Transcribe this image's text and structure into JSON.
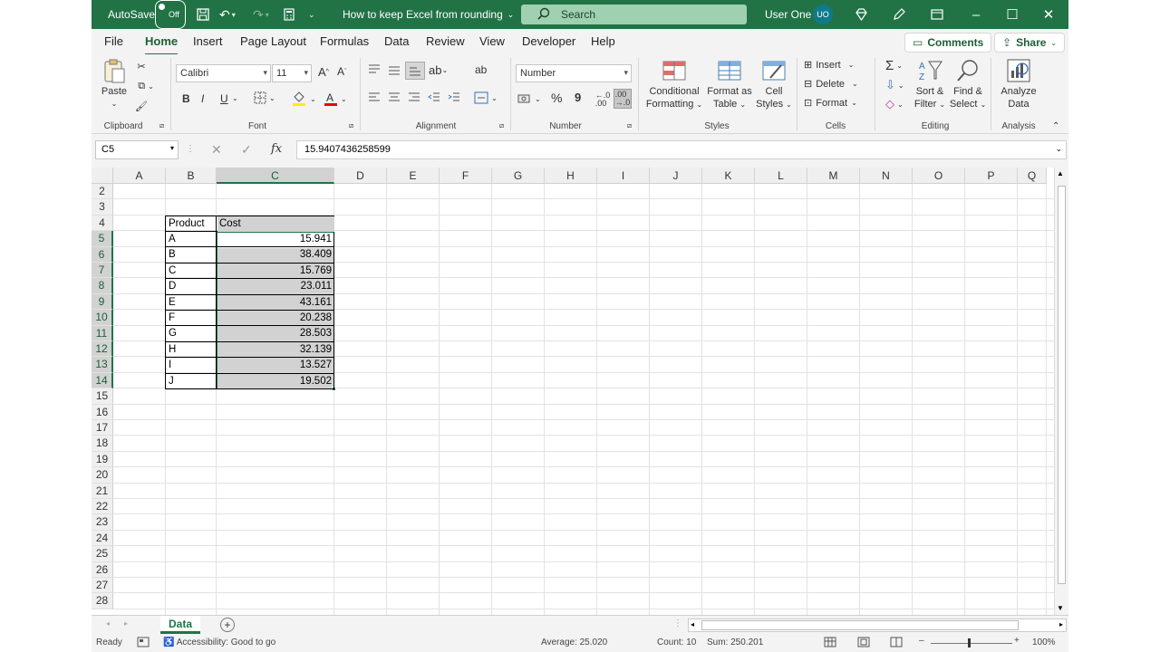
{
  "titlebar": {
    "autosave_label": "AutoSave",
    "autosave_state": "Off",
    "doc_title": "How to keep Excel from rounding",
    "search_placeholder": "Search",
    "user_name": "User One",
    "user_initials": "UO"
  },
  "tabs": [
    "File",
    "Home",
    "Insert",
    "Page Layout",
    "Formulas",
    "Data",
    "Review",
    "View",
    "Developer",
    "Help"
  ],
  "active_tab": "Home",
  "comments_label": "Comments",
  "share_label": "Share",
  "ribbon": {
    "clipboard": {
      "paste": "Paste",
      "label": "Clipboard"
    },
    "font": {
      "family": "Calibri",
      "size": "11",
      "label": "Font",
      "bold": "B",
      "italic": "I",
      "underline": "U"
    },
    "alignment": {
      "label": "Alignment"
    },
    "number": {
      "format": "Number",
      "label": "Number",
      "percent": "%",
      "comma": "9"
    },
    "styles": {
      "cond_format_1": "Conditional",
      "cond_format_2": "Formatting",
      "format_table_1": "Format as",
      "format_table_2": "Table",
      "cell_styles_1": "Cell",
      "cell_styles_2": "Styles",
      "label": "Styles"
    },
    "cells": {
      "insert": "Insert",
      "delete": "Delete",
      "format": "Format",
      "label": "Cells"
    },
    "editing": {
      "sort_1": "Sort &",
      "sort_2": "Filter",
      "find_1": "Find &",
      "find_2": "Select",
      "label": "Editing"
    },
    "analysis": {
      "analyze_1": "Analyze",
      "analyze_2": "Data",
      "label": "Analysis"
    }
  },
  "formula_bar": {
    "name_box": "C5",
    "fx": "fx",
    "value": "15.9407436258599"
  },
  "columns": [
    "A",
    "B",
    "C",
    "D",
    "E",
    "F",
    "G",
    "H",
    "I",
    "J",
    "K",
    "L",
    "M",
    "N",
    "O",
    "P",
    "Q"
  ],
  "rows": [
    "2",
    "3",
    "4",
    "5",
    "6",
    "7",
    "8",
    "9",
    "10",
    "11",
    "12",
    "13",
    "14",
    "15",
    "16",
    "17",
    "18",
    "19",
    "20",
    "21",
    "22",
    "23",
    "24",
    "25",
    "26",
    "27",
    "28"
  ],
  "table": {
    "header_product": "Product",
    "header_cost": "Cost",
    "products": [
      "A",
      "B",
      "C",
      "D",
      "E",
      "F",
      "G",
      "H",
      "I",
      "J"
    ],
    "costs": [
      "15.941",
      "38.409",
      "15.769",
      "23.011",
      "43.161",
      "20.238",
      "28.503",
      "32.139",
      "13.527",
      "19.502"
    ]
  },
  "sheet_tab": "Data",
  "status": {
    "ready": "Ready",
    "accessibility": "Accessibility: Good to go",
    "average": "Average: 25.020",
    "count": "Count: 10",
    "sum": "Sum: 250.201",
    "zoom": "100%"
  },
  "colors": {
    "excel_green": "#217346",
    "selection_gray": "#d2d2d2"
  }
}
